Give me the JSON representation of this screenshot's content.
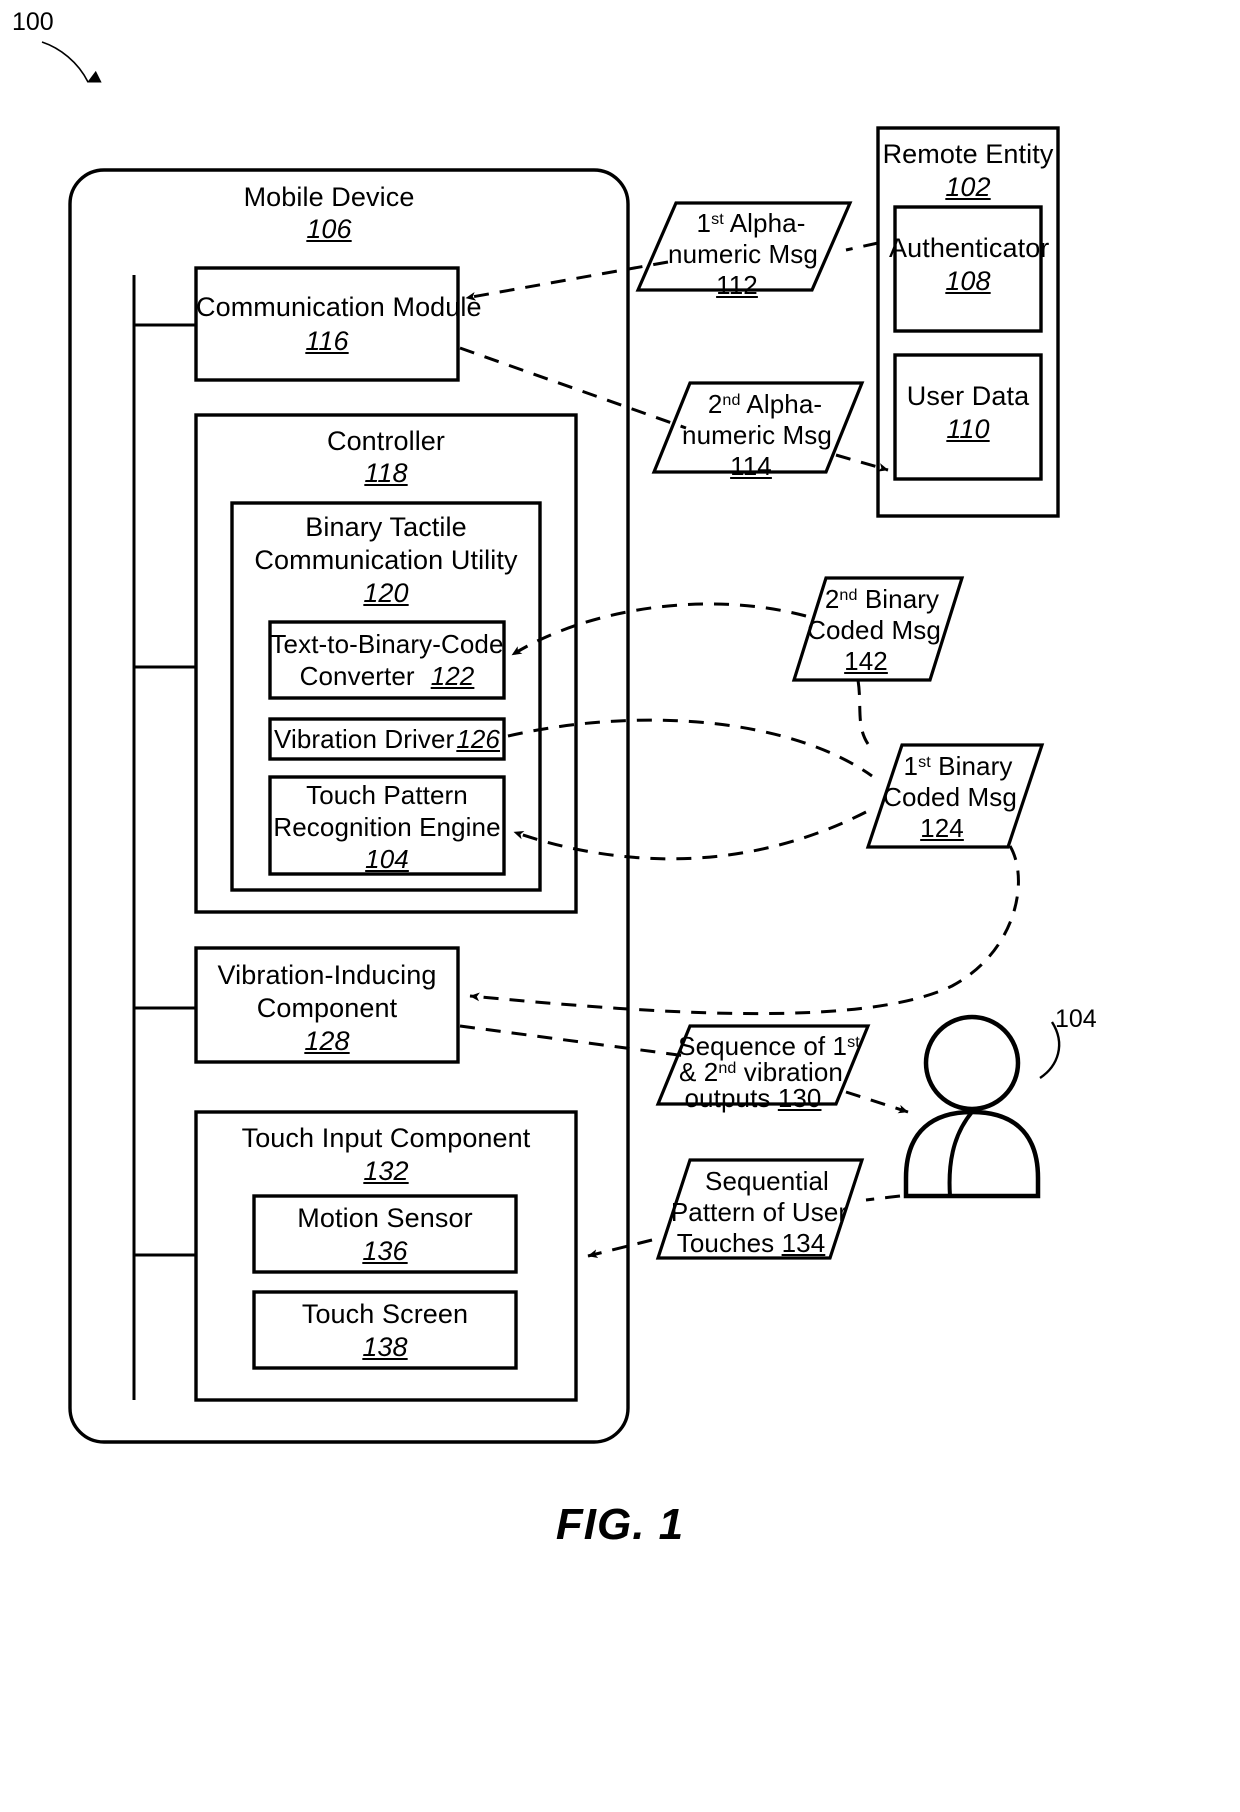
{
  "figure": {
    "caption": "FIG. 1",
    "top_reference": "100",
    "user_reference": "104"
  },
  "mobile_device": {
    "title": "Mobile Device",
    "ref": "106",
    "communication_module": {
      "title": "Communication Module",
      "ref": "116"
    },
    "controller": {
      "title": "Controller",
      "ref": "118",
      "binary_tactile_utility": {
        "title_line1": "Binary Tactile",
        "title_line2": "Communication Utility",
        "ref": "120",
        "text_to_binary_converter": {
          "line1": "Text-to-Binary-Code",
          "line2": "Converter",
          "ref": "122"
        },
        "vibration_driver": {
          "title": "Vibration Driver",
          "ref": "126"
        },
        "touch_pattern_engine": {
          "line1": "Touch Pattern",
          "line2": "Recognition Engine",
          "ref": "104"
        }
      }
    },
    "vibration_inducing_component": {
      "line1": "Vibration-Inducing",
      "line2": "Component",
      "ref": "128"
    },
    "touch_input_component": {
      "title": "Touch Input Component",
      "ref": "132",
      "motion_sensor": {
        "title": "Motion Sensor",
        "ref": "136"
      },
      "touch_screen": {
        "title": "Touch Screen",
        "ref": "138"
      }
    }
  },
  "remote_entity": {
    "title": "Remote Entity",
    "ref": "102",
    "authenticator": {
      "title": "Authenticator",
      "ref": "108"
    },
    "user_data": {
      "title": "User Data",
      "ref": "110"
    }
  },
  "messages": {
    "first_alphanumeric": {
      "line1_pre": "1",
      "line1_sup": "st",
      "line1_post": " Alpha-",
      "line2": "numeric Msg",
      "ref": "112"
    },
    "second_alphanumeric": {
      "line1_pre": "2",
      "line1_sup": "nd",
      "line1_post": " Alpha-",
      "line2": "numeric Msg",
      "ref": "114"
    },
    "second_binary_coded": {
      "line1_pre": "2",
      "line1_sup": "nd",
      "line1_post": " Binary",
      "line2": "Coded Msg",
      "ref": "142"
    },
    "first_binary_coded": {
      "line1_pre": "1",
      "line1_sup": "st",
      "line1_post": " Binary",
      "line2": "Coded Msg",
      "ref": "124"
    },
    "vibration_sequence": {
      "line1_pre": "Sequence of 1",
      "line1_sup": "st",
      "line2_pre": "& 2",
      "line2_sup": "nd",
      "line2_post": " vibration",
      "line3": "outputs ",
      "ref": "130"
    },
    "touch_pattern_sequence": {
      "line1": "Sequential",
      "line2": "Pattern of User",
      "line3": "Touches ",
      "ref": "134"
    }
  },
  "colors": {
    "stroke": "#000000",
    "background": "#ffffff"
  }
}
